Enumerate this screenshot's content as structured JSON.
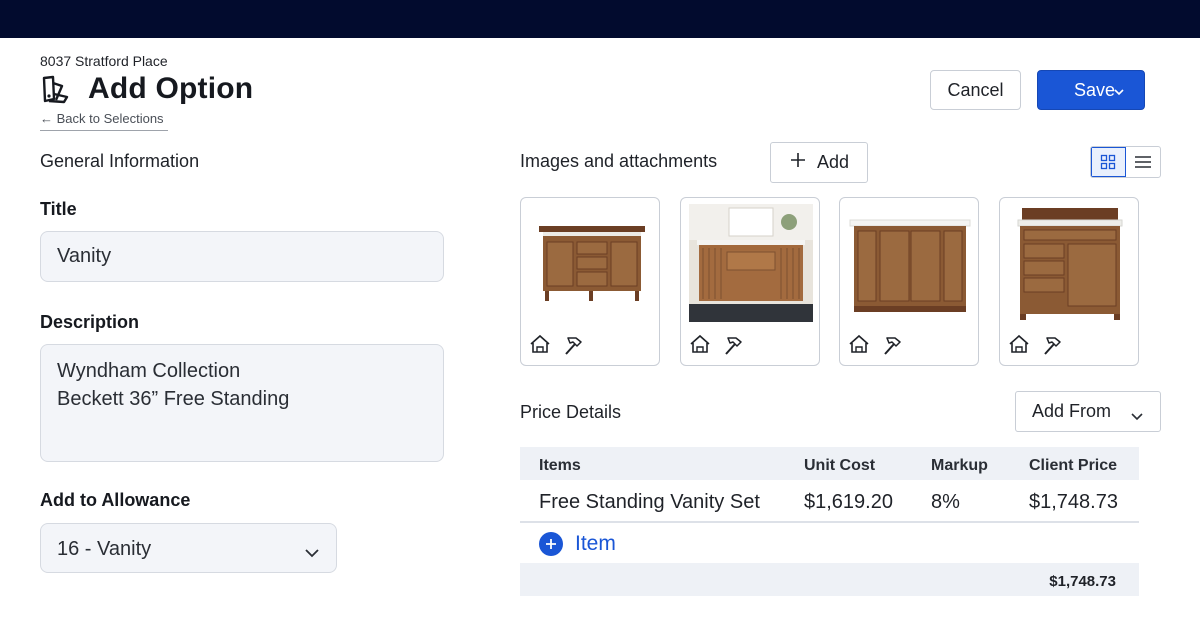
{
  "header": {
    "address": "8037 Stratford Place",
    "title": "Add Option",
    "back_link": "← Back to Selections",
    "cancel_label": "Cancel",
    "save_label": "Save"
  },
  "general": {
    "section_title": "General Information",
    "title_label": "Title",
    "title_value": "Vanity",
    "description_label": "Description",
    "description_line1": "Wyndham Collection",
    "description_line2": "Beckett 36” Free Standing",
    "allowance_label": "Add to Allowance",
    "allowance_value": "16 - Vanity"
  },
  "images": {
    "section_title": "Images and attachments",
    "add_label": "Add",
    "thumbnails": [
      {
        "icon_home": "home-icon",
        "icon_build": "hammer-icon"
      },
      {
        "icon_home": "home-icon",
        "icon_build": "hammer-icon"
      },
      {
        "icon_home": "home-icon",
        "icon_build": "hammer-icon"
      },
      {
        "icon_home": "home-icon",
        "icon_build": "hammer-icon"
      }
    ]
  },
  "price": {
    "section_title": "Price Details",
    "add_from_label": "Add From",
    "columns": [
      "Items",
      "Unit Cost",
      "Markup",
      "Client Price"
    ],
    "rows": [
      {
        "item": "Free Standing Vanity Set",
        "unit_cost": "$1,619.20",
        "markup": "8%",
        "client_price": "$1,748.73"
      }
    ],
    "add_item_label": "Item",
    "total": "$1,748.73"
  },
  "colors": {
    "topbar": "#020b2e",
    "accent": "#1a56d6",
    "input_bg": "#f3f5f9"
  }
}
